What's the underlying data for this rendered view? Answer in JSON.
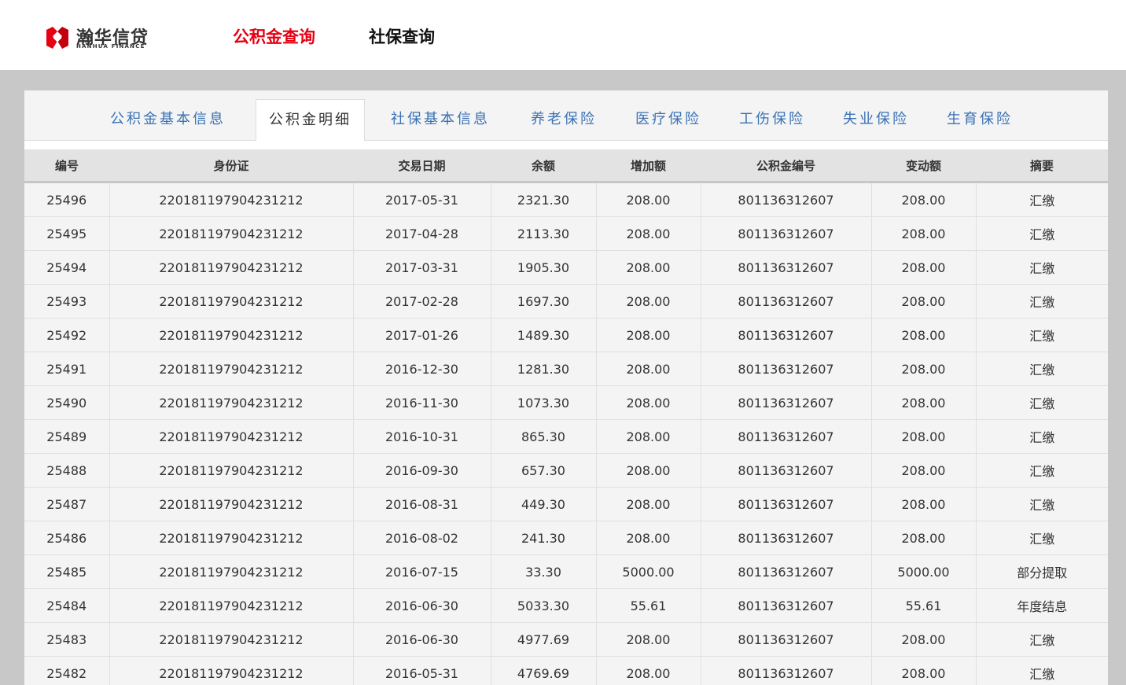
{
  "brand": {
    "name_cn": "瀚华信贷",
    "name_en": "HANHUA FINANCE",
    "accent_color": "#e60012"
  },
  "nav": {
    "items": [
      {
        "label": "公积金查询",
        "active": true
      },
      {
        "label": "社保查询",
        "active": false
      }
    ]
  },
  "tabs": [
    {
      "label": "公积金基本信息",
      "active": false
    },
    {
      "label": "公积金明细",
      "active": true
    },
    {
      "label": "社保基本信息",
      "active": false
    },
    {
      "label": "养老保险",
      "active": false
    },
    {
      "label": "医疗保险",
      "active": false
    },
    {
      "label": "工伤保险",
      "active": false
    },
    {
      "label": "失业保险",
      "active": false
    },
    {
      "label": "生育保险",
      "active": false
    }
  ],
  "table": {
    "headers": [
      "编号",
      "身份证",
      "交易日期",
      "余额",
      "增加额",
      "公积金编号",
      "变动额",
      "摘要"
    ],
    "rows": [
      [
        "25496",
        "220181197904231212",
        "2017-05-31",
        "2321.30",
        "208.00",
        "801136312607",
        "208.00",
        "汇缴"
      ],
      [
        "25495",
        "220181197904231212",
        "2017-04-28",
        "2113.30",
        "208.00",
        "801136312607",
        "208.00",
        "汇缴"
      ],
      [
        "25494",
        "220181197904231212",
        "2017-03-31",
        "1905.30",
        "208.00",
        "801136312607",
        "208.00",
        "汇缴"
      ],
      [
        "25493",
        "220181197904231212",
        "2017-02-28",
        "1697.30",
        "208.00",
        "801136312607",
        "208.00",
        "汇缴"
      ],
      [
        "25492",
        "220181197904231212",
        "2017-01-26",
        "1489.30",
        "208.00",
        "801136312607",
        "208.00",
        "汇缴"
      ],
      [
        "25491",
        "220181197904231212",
        "2016-12-30",
        "1281.30",
        "208.00",
        "801136312607",
        "208.00",
        "汇缴"
      ],
      [
        "25490",
        "220181197904231212",
        "2016-11-30",
        "1073.30",
        "208.00",
        "801136312607",
        "208.00",
        "汇缴"
      ],
      [
        "25489",
        "220181197904231212",
        "2016-10-31",
        "865.30",
        "208.00",
        "801136312607",
        "208.00",
        "汇缴"
      ],
      [
        "25488",
        "220181197904231212",
        "2016-09-30",
        "657.30",
        "208.00",
        "801136312607",
        "208.00",
        "汇缴"
      ],
      [
        "25487",
        "220181197904231212",
        "2016-08-31",
        "449.30",
        "208.00",
        "801136312607",
        "208.00",
        "汇缴"
      ],
      [
        "25486",
        "220181197904231212",
        "2016-08-02",
        "241.30",
        "208.00",
        "801136312607",
        "208.00",
        "汇缴"
      ],
      [
        "25485",
        "220181197904231212",
        "2016-07-15",
        "33.30",
        "5000.00",
        "801136312607",
        "5000.00",
        "部分提取"
      ],
      [
        "25484",
        "220181197904231212",
        "2016-06-30",
        "5033.30",
        "55.61",
        "801136312607",
        "55.61",
        "年度结息"
      ],
      [
        "25483",
        "220181197904231212",
        "2016-06-30",
        "4977.69",
        "208.00",
        "801136312607",
        "208.00",
        "汇缴"
      ],
      [
        "25482",
        "220181197904231212",
        "2016-05-31",
        "4769.69",
        "208.00",
        "801136312607",
        "208.00",
        "汇缴"
      ]
    ]
  }
}
